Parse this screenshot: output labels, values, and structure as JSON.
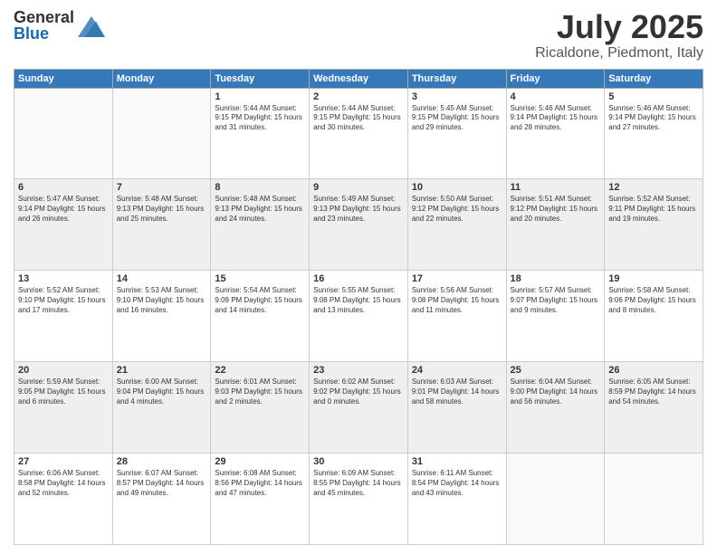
{
  "header": {
    "logo_general": "General",
    "logo_blue": "Blue",
    "title": "July 2025",
    "location": "Ricaldone, Piedmont, Italy"
  },
  "days_of_week": [
    "Sunday",
    "Monday",
    "Tuesday",
    "Wednesday",
    "Thursday",
    "Friday",
    "Saturday"
  ],
  "weeks": [
    [
      {
        "day": "",
        "info": ""
      },
      {
        "day": "",
        "info": ""
      },
      {
        "day": "1",
        "info": "Sunrise: 5:44 AM\nSunset: 9:15 PM\nDaylight: 15 hours\nand 31 minutes."
      },
      {
        "day": "2",
        "info": "Sunrise: 5:44 AM\nSunset: 9:15 PM\nDaylight: 15 hours\nand 30 minutes."
      },
      {
        "day": "3",
        "info": "Sunrise: 5:45 AM\nSunset: 9:15 PM\nDaylight: 15 hours\nand 29 minutes."
      },
      {
        "day": "4",
        "info": "Sunrise: 5:46 AM\nSunset: 9:14 PM\nDaylight: 15 hours\nand 28 minutes."
      },
      {
        "day": "5",
        "info": "Sunrise: 5:46 AM\nSunset: 9:14 PM\nDaylight: 15 hours\nand 27 minutes."
      }
    ],
    [
      {
        "day": "6",
        "info": "Sunrise: 5:47 AM\nSunset: 9:14 PM\nDaylight: 15 hours\nand 26 minutes."
      },
      {
        "day": "7",
        "info": "Sunrise: 5:48 AM\nSunset: 9:13 PM\nDaylight: 15 hours\nand 25 minutes."
      },
      {
        "day": "8",
        "info": "Sunrise: 5:48 AM\nSunset: 9:13 PM\nDaylight: 15 hours\nand 24 minutes."
      },
      {
        "day": "9",
        "info": "Sunrise: 5:49 AM\nSunset: 9:13 PM\nDaylight: 15 hours\nand 23 minutes."
      },
      {
        "day": "10",
        "info": "Sunrise: 5:50 AM\nSunset: 9:12 PM\nDaylight: 15 hours\nand 22 minutes."
      },
      {
        "day": "11",
        "info": "Sunrise: 5:51 AM\nSunset: 9:12 PM\nDaylight: 15 hours\nand 20 minutes."
      },
      {
        "day": "12",
        "info": "Sunrise: 5:52 AM\nSunset: 9:11 PM\nDaylight: 15 hours\nand 19 minutes."
      }
    ],
    [
      {
        "day": "13",
        "info": "Sunrise: 5:52 AM\nSunset: 9:10 PM\nDaylight: 15 hours\nand 17 minutes."
      },
      {
        "day": "14",
        "info": "Sunrise: 5:53 AM\nSunset: 9:10 PM\nDaylight: 15 hours\nand 16 minutes."
      },
      {
        "day": "15",
        "info": "Sunrise: 5:54 AM\nSunset: 9:09 PM\nDaylight: 15 hours\nand 14 minutes."
      },
      {
        "day": "16",
        "info": "Sunrise: 5:55 AM\nSunset: 9:08 PM\nDaylight: 15 hours\nand 13 minutes."
      },
      {
        "day": "17",
        "info": "Sunrise: 5:56 AM\nSunset: 9:08 PM\nDaylight: 15 hours\nand 11 minutes."
      },
      {
        "day": "18",
        "info": "Sunrise: 5:57 AM\nSunset: 9:07 PM\nDaylight: 15 hours\nand 9 minutes."
      },
      {
        "day": "19",
        "info": "Sunrise: 5:58 AM\nSunset: 9:06 PM\nDaylight: 15 hours\nand 8 minutes."
      }
    ],
    [
      {
        "day": "20",
        "info": "Sunrise: 5:59 AM\nSunset: 9:05 PM\nDaylight: 15 hours\nand 6 minutes."
      },
      {
        "day": "21",
        "info": "Sunrise: 6:00 AM\nSunset: 9:04 PM\nDaylight: 15 hours\nand 4 minutes."
      },
      {
        "day": "22",
        "info": "Sunrise: 6:01 AM\nSunset: 9:03 PM\nDaylight: 15 hours\nand 2 minutes."
      },
      {
        "day": "23",
        "info": "Sunrise: 6:02 AM\nSunset: 9:02 PM\nDaylight: 15 hours\nand 0 minutes."
      },
      {
        "day": "24",
        "info": "Sunrise: 6:03 AM\nSunset: 9:01 PM\nDaylight: 14 hours\nand 58 minutes."
      },
      {
        "day": "25",
        "info": "Sunrise: 6:04 AM\nSunset: 9:00 PM\nDaylight: 14 hours\nand 56 minutes."
      },
      {
        "day": "26",
        "info": "Sunrise: 6:05 AM\nSunset: 8:59 PM\nDaylight: 14 hours\nand 54 minutes."
      }
    ],
    [
      {
        "day": "27",
        "info": "Sunrise: 6:06 AM\nSunset: 8:58 PM\nDaylight: 14 hours\nand 52 minutes."
      },
      {
        "day": "28",
        "info": "Sunrise: 6:07 AM\nSunset: 8:57 PM\nDaylight: 14 hours\nand 49 minutes."
      },
      {
        "day": "29",
        "info": "Sunrise: 6:08 AM\nSunset: 8:56 PM\nDaylight: 14 hours\nand 47 minutes."
      },
      {
        "day": "30",
        "info": "Sunrise: 6:09 AM\nSunset: 8:55 PM\nDaylight: 14 hours\nand 45 minutes."
      },
      {
        "day": "31",
        "info": "Sunrise: 6:11 AM\nSunset: 8:54 PM\nDaylight: 14 hours\nand 43 minutes."
      },
      {
        "day": "",
        "info": ""
      },
      {
        "day": "",
        "info": ""
      }
    ]
  ]
}
